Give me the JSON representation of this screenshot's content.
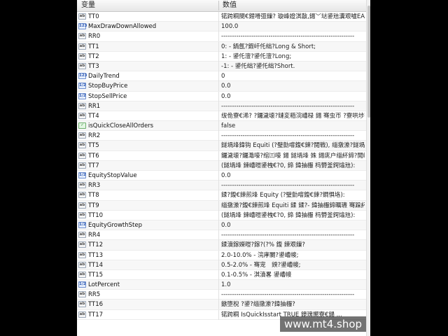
{
  "header": {
    "variable": "变量",
    "value": "数值"
  },
  "rows": [
    {
      "icon": "ab",
      "name": "TT0",
      "value": "锘跨粡閿€鍟嗗弬鏁? 璇峰嬁淇敼,鍚﹀垯鍙兘瀵艰嚧EA鏃犳硶姝ｅ父杩愯(%..."
    },
    {
      "icon": "num",
      "name": "MaxDrawDownAllowed",
      "value": "100.0"
    },
    {
      "icon": "ab",
      "name": "RR0",
      "value": "--------------------------------------------------------------"
    },
    {
      "icon": "ab",
      "name": "TT1",
      "value": "0: - 鍋氬?鍜屽仛绌?Long & Short;"
    },
    {
      "icon": "ab",
      "name": "TT2",
      "value": "1: - 鍙仛澶?鍙仛澶?Long;"
    },
    {
      "icon": "ab",
      "name": "TT3",
      "value": "-1: - 鍙仛绌?鍙仛绌?Short."
    },
    {
      "icon": "num",
      "name": "DailyTrend",
      "value": "0"
    },
    {
      "icon": "dbl",
      "name": "StopBuyPrice",
      "value": "0.0"
    },
    {
      "icon": "dbl",
      "name": "StopSellPrice",
      "value": "0.0"
    },
    {
      "icon": "ab",
      "name": "RR1",
      "value": "--------------------------------------------------------------"
    },
    {
      "icon": "ab",
      "name": "TT4",
      "value": "绂佹寮€浠?  ?钃濊壊?鏈変粨浣嶆椂 鍚 骞虫帀 ?寮哄埗骞充粨..."
    },
    {
      "icon": "bool",
      "name": "isQuickCloseAllOrders",
      "value": "false"
    },
    {
      "icon": "ab",
      "name": "RR2",
      "value": "--------------------------------------------------------------"
    },
    {
      "icon": "ab",
      "name": "TT5",
      "value": "鐩堝埄鍏钩 Equiti (?璧勯噾鍑€鍊?閲戦), 缁撴潫?鐩堝埄骞充粨 ?..."
    },
    {
      "icon": "ab",
      "name": "TT6",
      "value": "钃濊壊?钃濈嚎?绾㈢嚎 鍚 鐩堝埄  姝 鍚庣户缁紑鍗?閲嶆柊寮€?..."
    },
    {
      "icon": "ab",
      "name": "TT7",
      "value": "(鐩堝埄 鍊嶆暟鍙栧€?0, 鍗 鍏抽棴     杩欎釜鍔熻兘):"
    },
    {
      "icon": "dbl",
      "name": "EquityStopValue",
      "value": "0.0"
    },
    {
      "icon": "ab",
      "name": "RR3",
      "value": "--------------------------------------------------------------"
    },
    {
      "icon": "ab",
      "name": "TT8",
      "value": "鍒?鍑€鍊煎埄 Equity (?璧勯噾鍑€鍊?鐧惧垎):"
    },
    {
      "icon": "ab",
      "name": "TT9",
      "value": "缁撴潫?鍑€鍊煎埄 Equiti 鍒 鍒?- 鍏抽棴鍗曞瓙 骞跺紑鍗?鍙??..."
    },
    {
      "icon": "ab",
      "name": "TT10",
      "value": "(鐩堝埄 鍊嶆暟鍙栧€?0, 鍗 鍏抽棴     杩欎釜鍔熻兘):"
    },
    {
      "icon": "dbl",
      "name": "EquityGrowthStep",
      "value": "0.0"
    },
    {
      "icon": "ab",
      "name": "RR4",
      "value": "--------------------------------------------------------------"
    },
    {
      "icon": "ab",
      "name": "TT12",
      "value": "鍒濆鎵嬫暟?鎵?(?% 鍑 鍊艰鏁?"
    },
    {
      "icon": "ab",
      "name": "TT13",
      "value": "2.0-10.0% - 浣庨闄?鍙嶆帹;"
    },
    {
      "icon": "ab",
      "name": "TT14",
      "value": "0.5-2.0% - 骞宠　鍨?鍙嶆帹;"
    },
    {
      "icon": "ab",
      "name": "TT15",
      "value": "0.1-0.5% - 淇濆畧 鍙嶆帹"
    },
    {
      "icon": "dbl",
      "name": "LotPercent",
      "value": "1.0"
    },
    {
      "icon": "ab",
      "name": "RR5",
      "value": "--------------------------------------------------------------"
    },
    {
      "icon": "ab",
      "name": "TT16",
      "value": "鏃堕棿  ?鍙?缁撴潫?鍏抽棴?"
    },
    {
      "icon": "ab",
      "name": "TT17",
      "value": "锘跨粡 IsQuickIsstart  TRUE  鐐瑰嚮寮€鍚 ..."
    }
  ],
  "watermark": "www.mt4.shop"
}
